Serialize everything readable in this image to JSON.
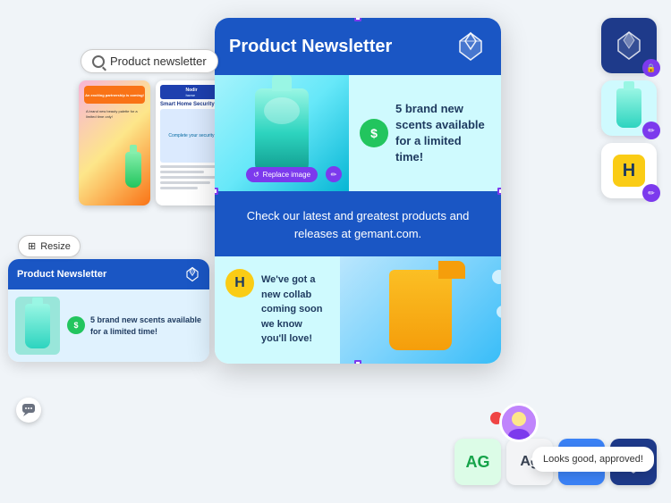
{
  "search": {
    "placeholder": "Product newsletter",
    "value": "Product newsletter"
  },
  "resize_btn": {
    "label": "Resize"
  },
  "mini_card": {
    "title": "Product Newsletter",
    "desc": "5 brand new scents available for a limited time!"
  },
  "main_card": {
    "title": "Product Newsletter",
    "section1_text": "5 brand new scents available for a limited time!",
    "section2_text": "Check our latest and greatest products and releases at gemant.com.",
    "section3_text": "We've got a new collab coming soon we know you'll love!",
    "replace_image_label": "Replace image"
  },
  "approval": {
    "message": "Looks good, approved!"
  },
  "icons": {
    "search": "🔍",
    "gem": "◈",
    "lock": "🔒",
    "edit": "✏",
    "chat": "💬",
    "resize": "⊞"
  },
  "brand_labels": {
    "ag1": "AG",
    "ag2": "Ag"
  }
}
